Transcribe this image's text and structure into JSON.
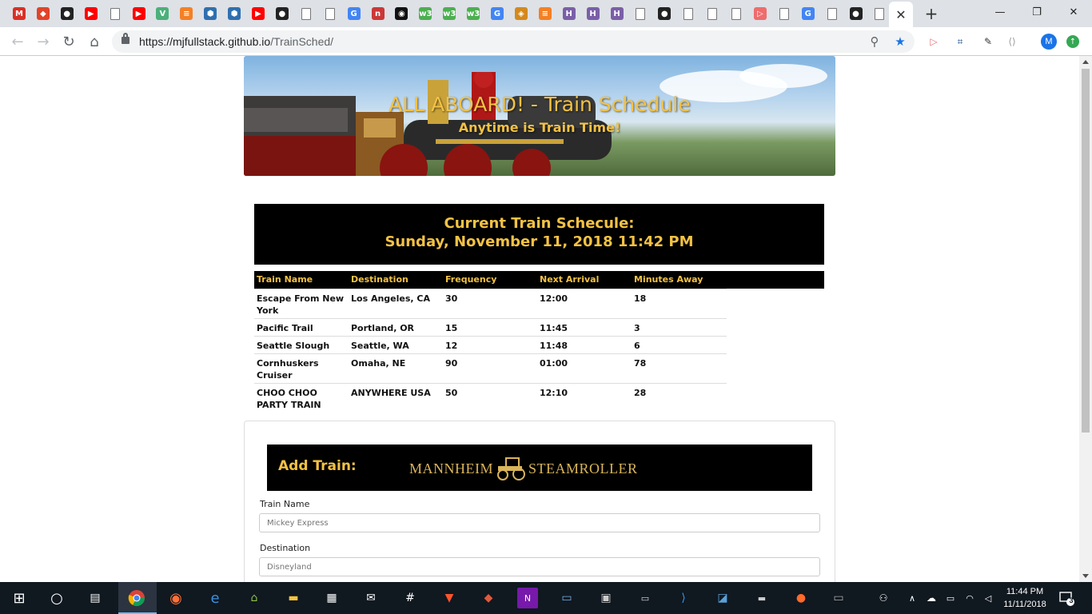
{
  "browser": {
    "url_host": "https://mjfullstack.github.io",
    "url_path": "/TrainSched/",
    "close_tab": "✕",
    "new_tab": "+",
    "avatar_initial": "M"
  },
  "tabs": [
    {
      "icon": "gmail-icon",
      "glyph": "M",
      "color": "#d93025"
    },
    {
      "icon": "gitlab-icon",
      "glyph": "◆",
      "color": "#e24329"
    },
    {
      "icon": "github-icon",
      "glyph": "●",
      "color": "#222222"
    },
    {
      "icon": "youtube-icon",
      "glyph": "▶",
      "color": "#ff0000"
    },
    {
      "icon": "document-icon",
      "glyph": "",
      "color": "doc"
    },
    {
      "icon": "youtube-icon",
      "glyph": "▶",
      "color": "#ff0000"
    },
    {
      "icon": "vue-icon",
      "glyph": "V",
      "color": "#4bb07a"
    },
    {
      "icon": "stackoverflow-icon",
      "glyph": "≡",
      "color": "#f48024"
    },
    {
      "icon": "box-icon",
      "glyph": "⬢",
      "color": "#2f6fb0"
    },
    {
      "icon": "box-icon",
      "glyph": "⬢",
      "color": "#2f6fb0"
    },
    {
      "icon": "youtube-icon",
      "glyph": "▶",
      "color": "#ff0000"
    },
    {
      "icon": "github-icon",
      "glyph": "●",
      "color": "#222222"
    },
    {
      "icon": "document-icon",
      "glyph": "",
      "color": "doc"
    },
    {
      "icon": "document-icon",
      "glyph": "",
      "color": "doc"
    },
    {
      "icon": "google-icon",
      "glyph": "G",
      "color": "#4285f4"
    },
    {
      "icon": "npm-icon",
      "glyph": "n",
      "color": "#cb3837"
    },
    {
      "icon": "record-icon",
      "glyph": "◉",
      "color": "#111111"
    },
    {
      "icon": "w3schools-icon",
      "glyph": "w3",
      "color": "#4caf50"
    },
    {
      "icon": "w3schools-icon",
      "glyph": "w3",
      "color": "#4caf50"
    },
    {
      "icon": "w3schools-icon",
      "glyph": "w3",
      "color": "#4caf50"
    },
    {
      "icon": "google-icon",
      "glyph": "G",
      "color": "#4285f4"
    },
    {
      "icon": "extension-icon",
      "glyph": "◈",
      "color": "#d4891c"
    },
    {
      "icon": "stackoverflow-icon",
      "glyph": "≡",
      "color": "#f48024"
    },
    {
      "icon": "hackerrank-icon",
      "glyph": "H",
      "color": "#7a5fa8"
    },
    {
      "icon": "hackerrank-icon",
      "glyph": "H",
      "color": "#7a5fa8"
    },
    {
      "icon": "hackerrank-icon",
      "glyph": "H",
      "color": "#7a5fa8"
    },
    {
      "icon": "document-icon",
      "glyph": "",
      "color": "doc"
    },
    {
      "icon": "github-icon",
      "glyph": "●",
      "color": "#222222"
    },
    {
      "icon": "document-icon",
      "glyph": "",
      "color": "doc"
    },
    {
      "icon": "document-icon",
      "glyph": "",
      "color": "doc"
    },
    {
      "icon": "document-icon",
      "glyph": "",
      "color": "doc"
    },
    {
      "icon": "screencast-icon",
      "glyph": "▷",
      "color": "#ef6c6c"
    },
    {
      "icon": "document-icon",
      "glyph": "",
      "color": "doc"
    },
    {
      "icon": "google-icon",
      "glyph": "G",
      "color": "#4285f4"
    },
    {
      "icon": "document-icon",
      "glyph": "",
      "color": "doc"
    },
    {
      "icon": "github-icon",
      "glyph": "●",
      "color": "#222222"
    },
    {
      "icon": "document-icon",
      "glyph": "",
      "color": "doc"
    }
  ],
  "page": {
    "hero_title": "ALL ABOARD! - Train Schedule",
    "hero_subtitle": "Anytime is Train Time!",
    "schedule_heading": "Current Train Schecule:",
    "schedule_datetime": "Sunday, November 11, 2018 11:42 PM",
    "table_headers": [
      "Train Name",
      "Destination",
      "Frequency",
      "Next Arrival",
      "Minutes Away"
    ],
    "trains": [
      {
        "name": "Escape From New York",
        "destination": "Los Angeles, CA",
        "frequency": "30",
        "next": "12:00",
        "away": "18"
      },
      {
        "name": "Pacific Trail",
        "destination": "Portland, OR",
        "frequency": "15",
        "next": "11:45",
        "away": "3"
      },
      {
        "name": "Seattle Slough",
        "destination": "Seattle, WA",
        "frequency": "12",
        "next": "11:48",
        "away": "6"
      },
      {
        "name": "Cornhuskers Cruiser",
        "destination": "Omaha, NE",
        "frequency": "90",
        "next": "01:00",
        "away": "78"
      },
      {
        "name": "CHOO CHOO PARTY TRAIN",
        "destination": "ANYWHERE USA",
        "frequency": "50",
        "next": "12:10",
        "away": "28"
      }
    ],
    "add_train_title": "Add Train:",
    "brand_left": "MANNHEIM",
    "brand_right": "STEAMROLLER",
    "form": {
      "train_name_label": "Train Name",
      "train_name_placeholder": "Mickey Express",
      "destination_label": "Destination",
      "destination_placeholder": "Disneyland"
    }
  },
  "taskbar": {
    "time": "11:44 PM",
    "date": "11/11/2018",
    "notifications": "3"
  },
  "colors": {
    "accent_gold": "#f3c244",
    "chrome_bg": "#dee1e6",
    "taskbar_bg": "#101820"
  }
}
